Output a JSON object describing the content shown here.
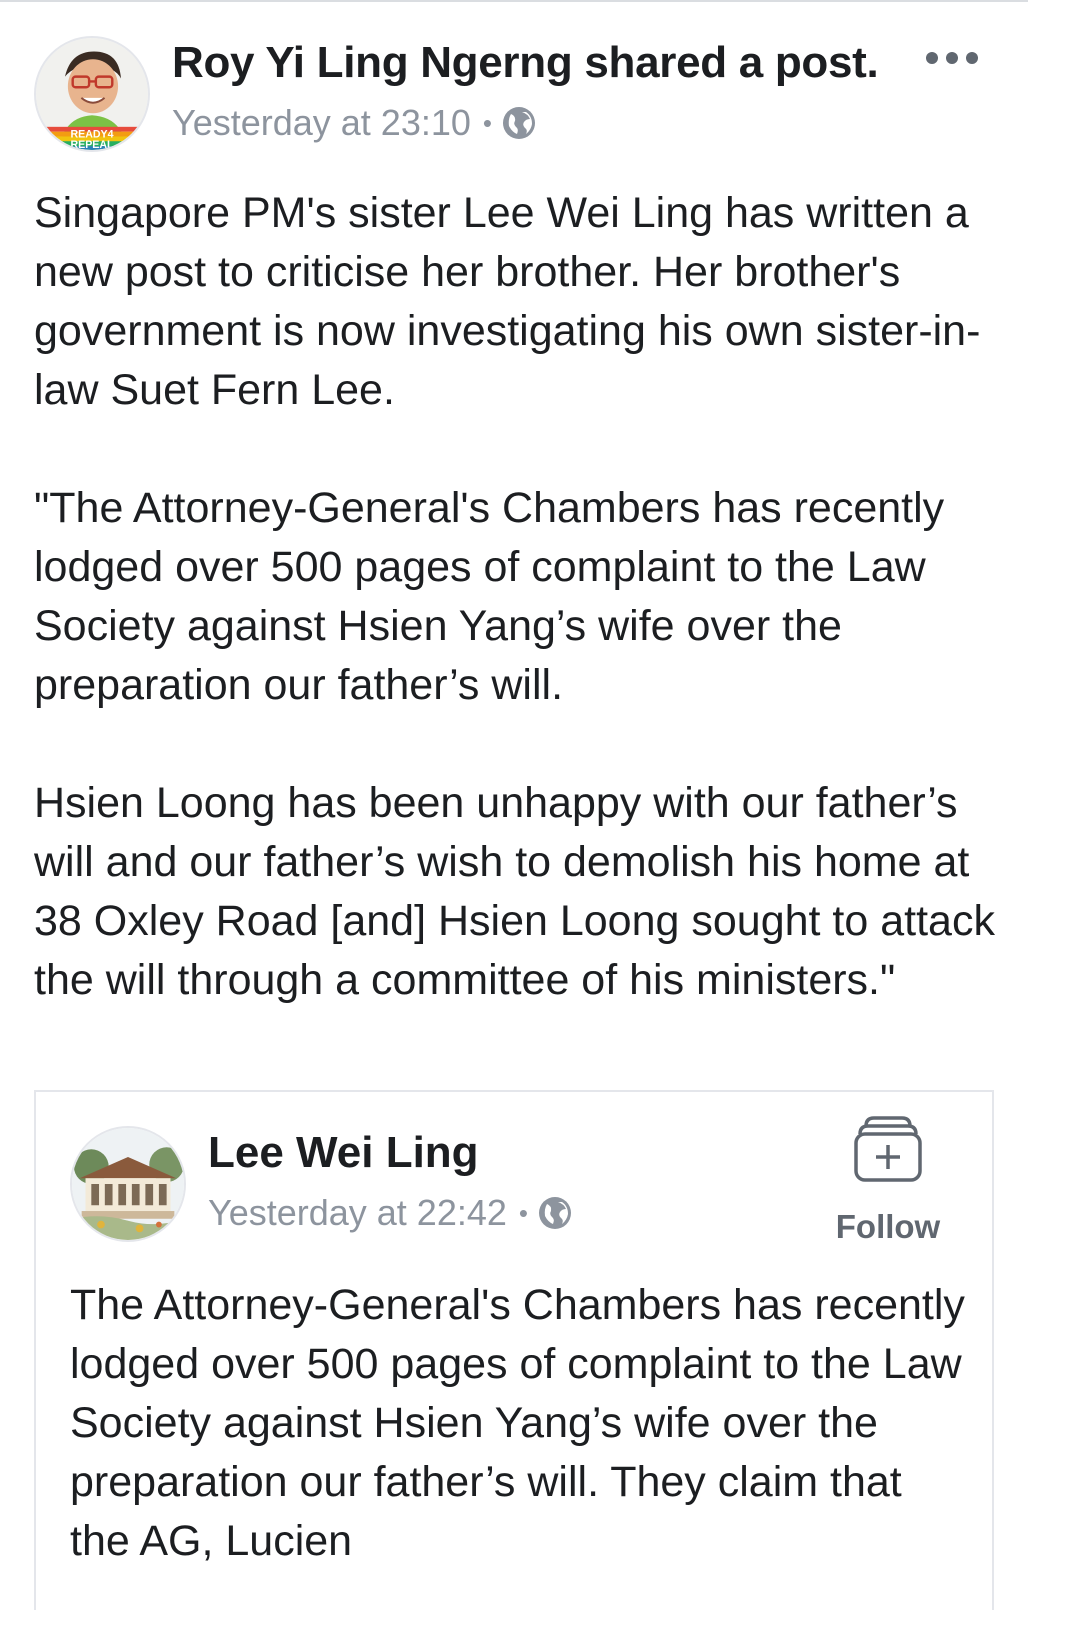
{
  "post": {
    "author": "Roy Yi Ling Ngerng shared a post.",
    "timestamp": "Yesterday at 23:10",
    "separator": "•",
    "privacy_icon": "globe-icon",
    "more_icon": "more-dots-icon",
    "avatar_badge": "READY4 REPEAL",
    "paragraphs": [
      "Singapore PM's sister Lee Wei Ling has written a new post to criticise her brother. Her brother's government is now investigating his own sister-in-law Suet Fern Lee.",
      "\"The Attorney-General's Chambers has recently lodged over 500 pages of complaint to the Law Society against Hsien Yang’s wife over the preparation our father’s will.",
      "Hsien Loong has been unhappy with our father’s will and our father’s wish to demolish his home at 38 Oxley Road [and] Hsien Loong sought to attack the will through a committee of his ministers.\""
    ]
  },
  "shared": {
    "author": "Lee Wei Ling",
    "timestamp": "Yesterday at 22:42",
    "separator": "•",
    "privacy_icon": "globe-icon",
    "follow_label": "Follow",
    "follow_icon": "follow-plus-icon",
    "text": "The Attorney-General's Chambers has recently lodged over 500 pages of complaint to the Law Society against Hsien Yang’s wife over the preparation our father’s will.  They claim that the AG, Lucien"
  },
  "colors": {
    "text": "#1c1e21",
    "meta": "#8d949e",
    "icon": "#606770",
    "border": "#e4e6eb"
  }
}
